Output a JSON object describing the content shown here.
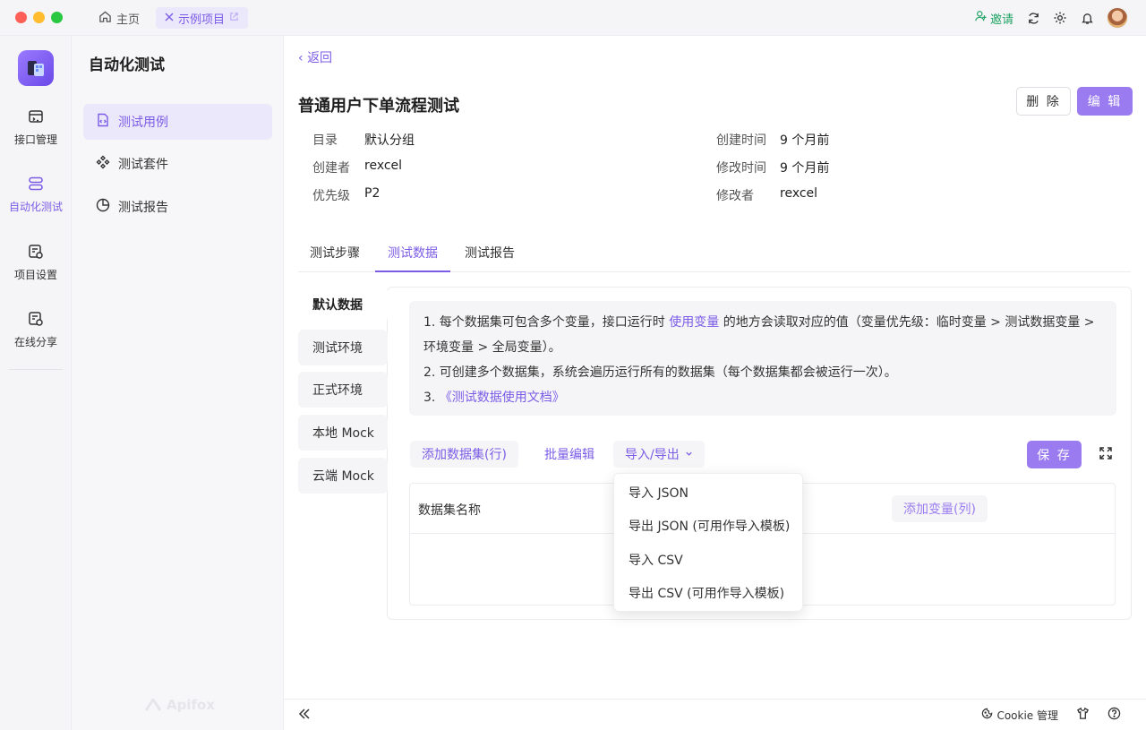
{
  "titlebar": {
    "home_tab": "主页",
    "project_tab": "示例项目",
    "invite": "邀请"
  },
  "rail": {
    "items": [
      {
        "label": "接口管理",
        "icon": "api-icon"
      },
      {
        "label": "自动化测试",
        "icon": "automation-icon"
      },
      {
        "label": "项目设置",
        "icon": "settings-doc-icon"
      },
      {
        "label": "在线分享",
        "icon": "share-doc-icon"
      }
    ]
  },
  "sidebar": {
    "title": "自动化测试",
    "items": [
      {
        "label": "测试用例",
        "icon": "test-case-icon"
      },
      {
        "label": "测试套件",
        "icon": "suite-icon"
      },
      {
        "label": "测试报告",
        "icon": "report-icon"
      }
    ],
    "watermark": "Apifox"
  },
  "main": {
    "back": "返回",
    "title": "普通用户下单流程测试",
    "delete_label": "删 除",
    "edit_label": "编 辑",
    "meta_left": [
      {
        "key": "目录",
        "value": "默认分组"
      },
      {
        "key": "创建者",
        "value": "rexcel"
      },
      {
        "key": "优先级",
        "value": "P2"
      }
    ],
    "meta_right": [
      {
        "key": "创建时间",
        "value": "9 个月前"
      },
      {
        "key": "修改时间",
        "value": "9 个月前"
      },
      {
        "key": "修改者",
        "value": "rexcel"
      }
    ],
    "tabs": [
      "测试步骤",
      "测试数据",
      "测试报告"
    ],
    "active_tab": 1
  },
  "data_panel": {
    "envs": [
      "默认数据",
      "测试环境",
      "正式环境",
      "本地 Mock",
      "云端 Mock"
    ],
    "info": {
      "line1_pre": "1. 每个数据集可包含多个变量，接口运行时",
      "line1_link": "使用变量",
      "line1_post": "的地方会读取对应的值（变量优先级：临时变量 > 测试数据变量 >",
      "line2": "环境变量 > 全局变量）。",
      "line3": "2. 可创建多个数据集，系统会遍历运行所有的数据集（每个数据集都会被运行一次）。",
      "line4_pre": "3. ",
      "line4_link": "《测试数据使用文档》"
    },
    "add_dataset": "添加数据集(行)",
    "batch_edit": "批量编辑",
    "import_export": "导入/导出",
    "save_label": "保 存",
    "table": {
      "col_name": "数据集名称",
      "add_col": "添加变量(列)"
    },
    "dropdown": [
      "导入 JSON",
      "导出 JSON (可用作导入模板)",
      "导入 CSV",
      "导出 CSV (可用作导入模板)"
    ]
  },
  "footer": {
    "cookie": "Cookie 管理"
  },
  "colors": {
    "accent": "#7b5ce6",
    "accent_button": "#9a7cf0",
    "invite_green": "#21a366"
  }
}
